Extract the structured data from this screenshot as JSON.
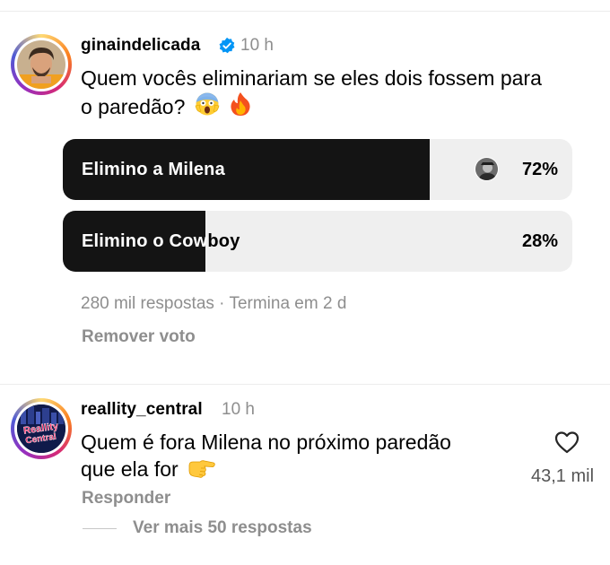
{
  "post": {
    "username": "ginaindelicada",
    "verified": true,
    "time": "10 h",
    "question_line1": "Quem vocês eliminariam se eles dois fossem para",
    "question_line2": "o paredão?",
    "emojis": [
      "face-screaming-in-fear",
      "fire"
    ],
    "poll": {
      "options": [
        {
          "label": "Elimino a Milena",
          "percent": "72%",
          "fraction": 0.72,
          "voted": true
        },
        {
          "label": "Elimino o Cowboy",
          "percent": "28%",
          "fraction": 0.28,
          "voted": false
        }
      ],
      "stats": "280 mil respostas · Termina em 2 d",
      "remove_vote": "Remover voto"
    }
  },
  "comment": {
    "username": "reallity_central",
    "time": "10 h",
    "avatar_text_1": "Reallity",
    "avatar_text_2": "Central",
    "text_line1": "Quem é fora Milena no próximo paredão",
    "text_line2": "que ela for",
    "emoji": "backhand-index-pointing-right",
    "likes": "43,1 mil",
    "reply": "Responder",
    "view_more": "Ver mais 50 respostas"
  },
  "colors": {
    "poll_fill": "#141414",
    "poll_track": "#efefef",
    "secondary_text": "#8e8e8e",
    "verified": "#0095f6"
  }
}
